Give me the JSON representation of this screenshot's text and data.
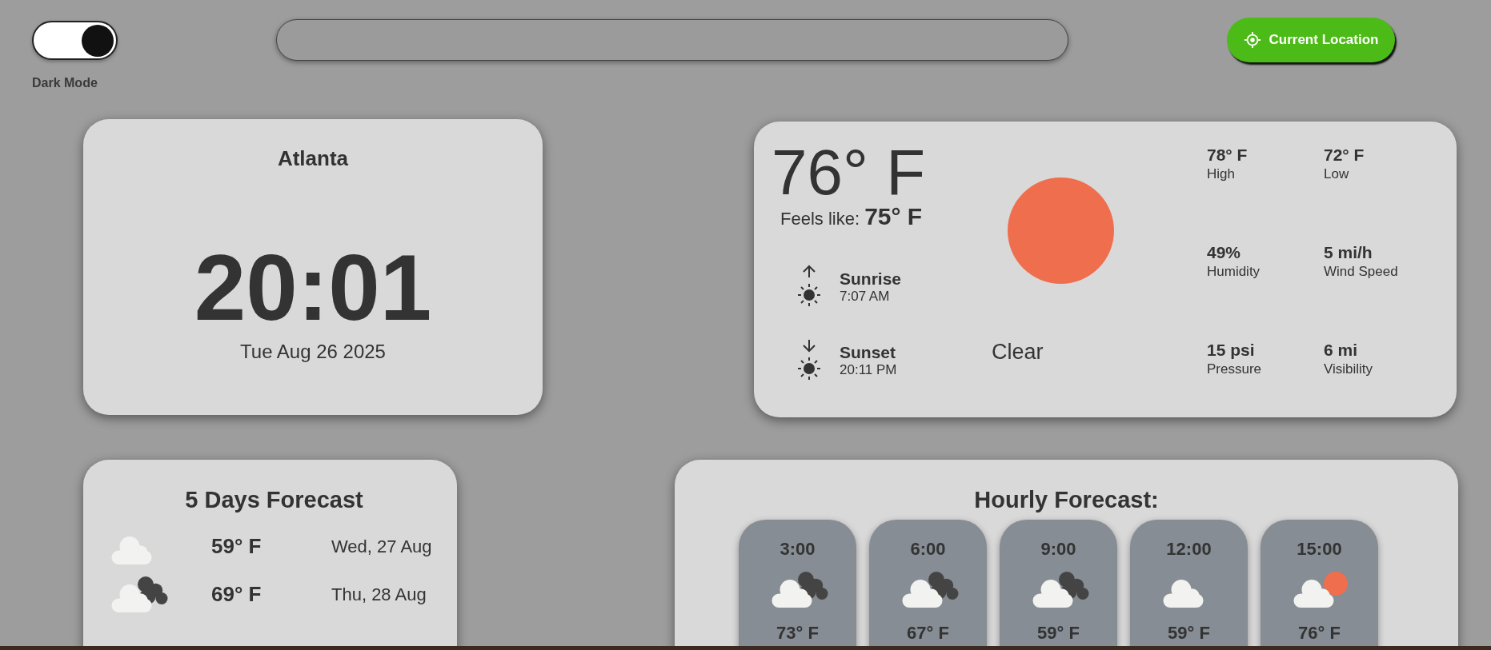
{
  "dark_mode": {
    "label": "Dark Mode",
    "on": true
  },
  "location_button": {
    "label": "Current Location"
  },
  "clock": {
    "city": "Atlanta",
    "time": "20:01",
    "date": "Tue Aug 26 2025"
  },
  "current": {
    "temperature": "76° F",
    "feels_like": "Feels like: **75° F**",
    "condition": "Clear",
    "sun_events": [
      {
        "kind": "rise",
        "label": "Sunrise",
        "time": "7:07 AM"
      },
      {
        "kind": "set",
        "label": "Sunset",
        "time": "20:11 PM"
      }
    ],
    "stats": [
      {
        "value": "78° F",
        "label": "High"
      },
      {
        "value": "72° F",
        "label": "Low"
      },
      {
        "value": "49%",
        "label": "Humidity"
      },
      {
        "value": "5 mi/h",
        "label": "Wind Speed"
      },
      {
        "value": "15 psi",
        "label": "Pressure"
      },
      {
        "value": "6 mi",
        "label": "Visibility"
      }
    ]
  },
  "daily": {
    "title": "5 Days Forecast",
    "days": [
      {
        "kind": "cloud",
        "temp": "59° F",
        "date": "Wed, 27 Aug"
      },
      {
        "kind": "clouds",
        "temp": "69° F",
        "date": "Thu, 28 Aug"
      }
    ]
  },
  "hourly": {
    "title": "Hourly Forecast:",
    "hours": [
      {
        "time": "3:00",
        "kind": "clouds",
        "temp": "73° F"
      },
      {
        "time": "6:00",
        "kind": "clouds",
        "temp": "67° F"
      },
      {
        "time": "9:00",
        "kind": "clouds",
        "temp": "59° F"
      },
      {
        "time": "12:00",
        "kind": "cloud",
        "temp": "59° F"
      },
      {
        "time": "15:00",
        "kind": "cloud-sun",
        "temp": "76° F"
      }
    ]
  }
}
